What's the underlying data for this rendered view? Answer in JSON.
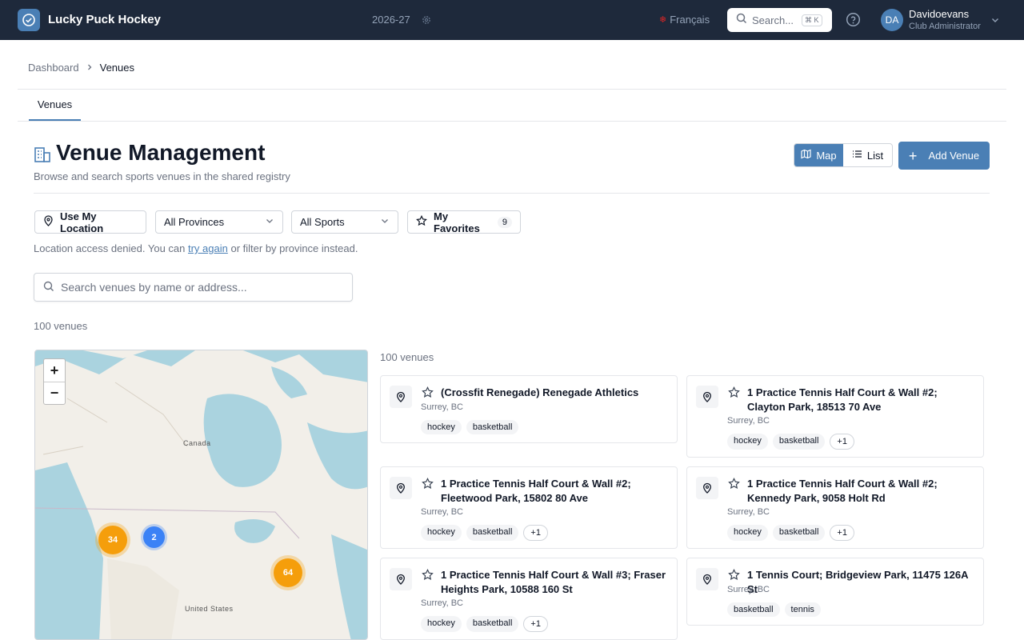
{
  "app": {
    "name": "Lucky Puck Hockey",
    "season": "2026-27",
    "language": "Français",
    "search_label": "Search...",
    "search_shortcut": "⌘ K",
    "user": {
      "initials": "DA",
      "name": "Davidoevans",
      "role": "Club Administrator"
    }
  },
  "breadcrumb": {
    "home": "Dashboard",
    "current": "Venues"
  },
  "tabs": [
    {
      "label": "Venues"
    }
  ],
  "page": {
    "title": "Venue Management",
    "subtitle": "Browse and search sports venues in the shared registry"
  },
  "view_toggle": {
    "map": "Map",
    "list": "List",
    "active": "map"
  },
  "add_button": "Add Venue",
  "filters": {
    "location": "Use My Location",
    "province": "All Provinces",
    "sport": "All Sports",
    "favorites": "My Favorites",
    "favorites_count": "9"
  },
  "location_msg": {
    "before": "Location access denied. You can ",
    "link": "try again",
    "after": " or filter by province instead."
  },
  "venue_search": {
    "placeholder": "Search venues by name or address..."
  },
  "counts": {
    "total": "100 venues",
    "list": "100 venues"
  },
  "map": {
    "labels": {
      "canada": "Canada",
      "us": "United States"
    },
    "clusters": [
      "34",
      "2",
      "64"
    ],
    "colors": {
      "orange": "#f59e0b",
      "blue": "#3b82f6"
    }
  },
  "venues": [
    {
      "name": "(Crossfit Renegade) Renegade Athletics",
      "location": "Surrey, BC",
      "tags": [
        "hockey",
        "basketball"
      ],
      "more": ""
    },
    {
      "name": "1 Practice Tennis Half Court & Wall #2; Clayton Park, 18513 70 Ave",
      "location": "Surrey, BC",
      "tags": [
        "hockey",
        "basketball"
      ],
      "more": "+1"
    },
    {
      "name": "1 Practice Tennis Half Court & Wall #2; Fleetwood Park, 15802 80 Ave",
      "location": "Surrey, BC",
      "tags": [
        "hockey",
        "basketball"
      ],
      "more": "+1"
    },
    {
      "name": "1 Practice Tennis Half Court & Wall #2; Kennedy Park, 9058 Holt Rd",
      "location": "Surrey, BC",
      "tags": [
        "hockey",
        "basketball"
      ],
      "more": "+1"
    },
    {
      "name": "1 Practice Tennis Half Court & Wall #3; Fraser Heights Park, 10588 160 St",
      "location": "Surrey, BC",
      "tags": [
        "hockey",
        "basketball"
      ],
      "more": "+1"
    },
    {
      "name": "1 Tennis Court; Bridgeview Park, 11475 126A St",
      "location": "Surrey, BC",
      "tags": [
        "basketball",
        "tennis"
      ],
      "more": ""
    }
  ],
  "colors": {
    "accent": "#4a7fb5",
    "topbar": "#1e293b"
  }
}
